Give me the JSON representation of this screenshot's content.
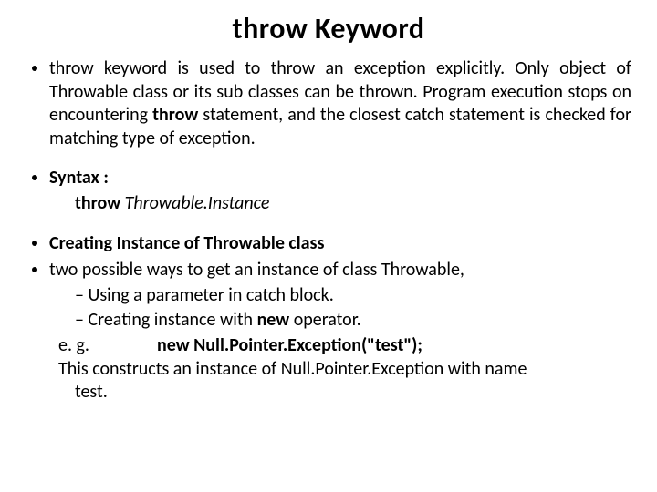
{
  "title": "throw Keyword",
  "bullets": {
    "intro_a": "throw keyword is used to throw an exception explicitly. Only object of Throwable class or its sub classes can be thrown. Program execution stops on encountering ",
    "intro_b_bold": "throw",
    "intro_c": " statement, and the closest catch statement is checked for matching type of exception.",
    "syntax_label": "Syntax :",
    "syntax_throw": "throw",
    "syntax_inst": " Throwable.Instance",
    "creating_heading": "Creating Instance of Throwable class",
    "two_ways": "two possible ways to get an instance of class Throwable,",
    "sub1": "Using a parameter in catch block.",
    "sub2_a": "Creating instance with ",
    "sub2_new": "new",
    "sub2_b": " operator.",
    "eg_label": "e. g.",
    "eg_code": "new Null.Pointer.Exception(\"test\");",
    "construct_a": "This constructs an instance of Null.Pointer.Exception with name",
    "construct_b": "test."
  }
}
